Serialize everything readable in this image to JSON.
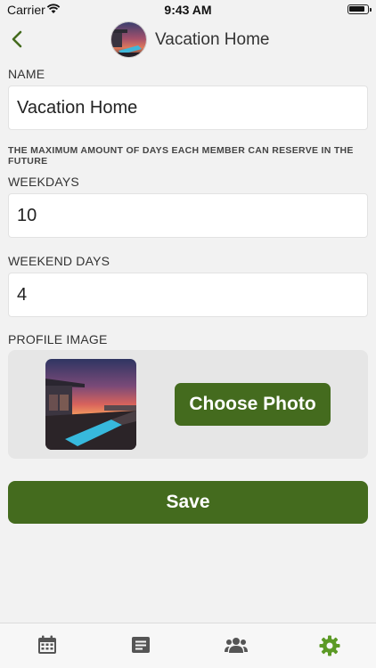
{
  "status_bar": {
    "carrier": "Carrier",
    "time": "9:43 AM"
  },
  "nav": {
    "title": "Vacation Home"
  },
  "form": {
    "name_label": "NAME",
    "name_value": "Vacation Home",
    "note": "THE MAXIMUM AMOUNT OF DAYS EACH MEMBER CAN RESERVE IN THE FUTURE",
    "weekdays_label": "WEEKDAYS",
    "weekdays_value": "10",
    "weekend_label": "WEEKEND DAYS",
    "weekend_value": "4",
    "profile_label": "PROFILE IMAGE",
    "choose_photo": "Choose Photo",
    "save": "Save"
  },
  "tabs": [
    {
      "icon": "calendar-icon",
      "active": false
    },
    {
      "icon": "list-icon",
      "active": false
    },
    {
      "icon": "users-icon",
      "active": false
    },
    {
      "icon": "gear-icon",
      "active": true
    }
  ],
  "colors": {
    "accent": "#446b1e",
    "active_tab": "#5c9a26",
    "inactive_tab": "#555555"
  }
}
